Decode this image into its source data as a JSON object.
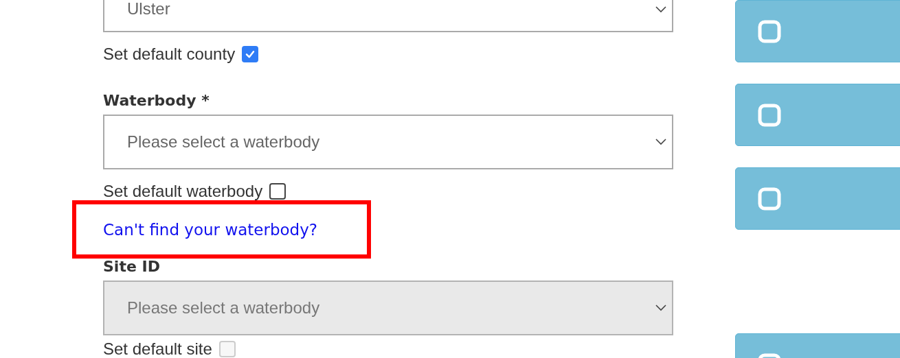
{
  "form_items": [
    {
      "kind": "field",
      "value": "Ulster",
      "disabled": false,
      "default_option": {
        "label": "Set default county",
        "checked": true,
        "disabled": false
      }
    },
    {
      "kind": "field",
      "label": "Waterbody *",
      "placeholder": "Please select a waterbody",
      "disabled": false,
      "default_option": {
        "label": "Set default waterbody",
        "checked": false,
        "disabled": false
      }
    },
    {
      "kind": "link",
      "text": "Can't find your waterbody?",
      "highlighted": true
    },
    {
      "kind": "field",
      "label": "Site ID",
      "placeholder": "Please select a waterbody",
      "disabled": true,
      "default_option": {
        "label": "Set default site",
        "checked": false,
        "disabled": true
      }
    }
  ],
  "side_buttons": [
    {
      "kind": "square-icon"
    },
    {
      "kind": "square-icon"
    },
    {
      "kind": "square-icon"
    },
    {
      "kind": "square-icon"
    }
  ]
}
